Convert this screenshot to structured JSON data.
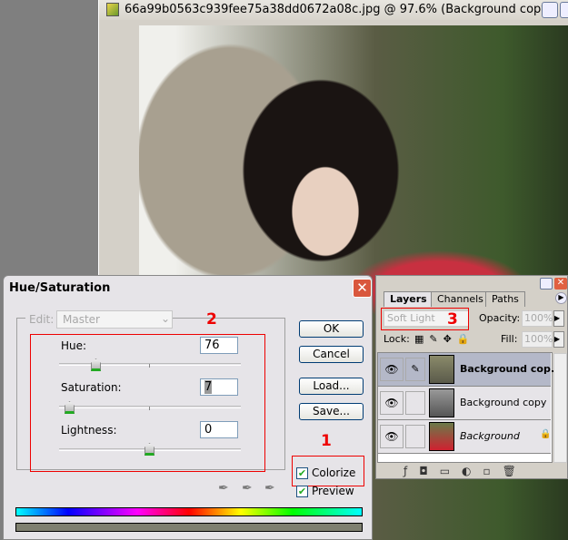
{
  "document": {
    "title": "66a99b0563c939fee75a38dd0672a08c.jpg @ 97.6% (Background copy..."
  },
  "dialog": {
    "title": "Hue/Saturation",
    "edit_label": "Edit:",
    "edit_value": "Master",
    "hue_label": "Hue:",
    "hue_value": "76",
    "saturation_label": "Saturation:",
    "saturation_value": "7",
    "lightness_label": "Lightness:",
    "lightness_value": "0",
    "ok": "OK",
    "cancel": "Cancel",
    "load": "Load...",
    "save": "Save...",
    "colorize_label": "Colorize",
    "colorize_checked": true,
    "preview_label": "Preview",
    "preview_checked": true,
    "annotation_1": "1",
    "annotation_2": "2"
  },
  "layers": {
    "tabs": [
      "Layers",
      "Channels",
      "Paths"
    ],
    "blend_mode": "Soft Light",
    "annotation_3": "3",
    "opacity_label": "Opacity:",
    "opacity_value": "100%",
    "lock_label": "Lock:",
    "fill_label": "Fill:",
    "fill_value": "100%",
    "items": [
      {
        "name": "Background cop...",
        "selected": true
      },
      {
        "name": "Background copy"
      },
      {
        "name": "Background",
        "locked": true
      }
    ]
  }
}
